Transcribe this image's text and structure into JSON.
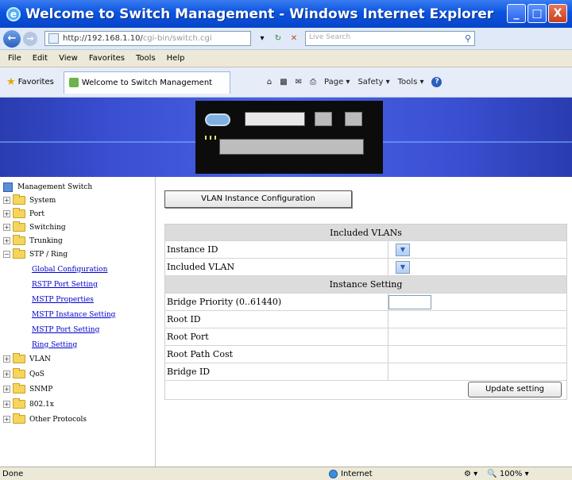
{
  "window": {
    "title": "Welcome to Switch Management - Windows Internet Explorer",
    "controls": [
      "_",
      "□",
      "X"
    ]
  },
  "address_bar": {
    "url_text": "http://192.168.1.10/",
    "url_dim": "cgi-bin/switch.cgi",
    "search_placeholder": "Live Search"
  },
  "menu": [
    "File",
    "Edit",
    "View",
    "Favorites",
    "Tools",
    "Help"
  ],
  "favorites_bar": {
    "favorites_label": "Favorites",
    "tab_title": "Welcome to Switch Management",
    "commands": [
      "Page ▾",
      "Safety ▾",
      "Tools ▾"
    ]
  },
  "sidebar": {
    "root": "Management Switch",
    "items": [
      {
        "label": "System",
        "type": "folder"
      },
      {
        "label": "Port",
        "type": "folder"
      },
      {
        "label": "Switching",
        "type": "folder"
      },
      {
        "label": "Trunking",
        "type": "folder"
      },
      {
        "label": "STP / Ring",
        "type": "folder-open"
      },
      {
        "label": "Global Configuration",
        "type": "link"
      },
      {
        "label": "RSTP Port Setting",
        "type": "link"
      },
      {
        "label": "MSTP Properties",
        "type": "link"
      },
      {
        "label": "MSTP Instance Setting",
        "type": "link"
      },
      {
        "label": "MSTP Port Setting",
        "type": "link"
      },
      {
        "label": "Ring Setting",
        "type": "link"
      },
      {
        "label": "VLAN",
        "type": "folder"
      },
      {
        "label": "QoS",
        "type": "folder"
      },
      {
        "label": "SNMP",
        "type": "folder"
      },
      {
        "label": "802.1x",
        "type": "folder"
      },
      {
        "label": "Other Protocols",
        "type": "folder"
      }
    ]
  },
  "main": {
    "page_title": "VLAN Instance Configuration",
    "included_vlans_header": "Included VLANs",
    "instance_id_label": "Instance ID",
    "included_vlan_label": "Included VLAN",
    "instance_setting_header": "Instance Setting",
    "bridge_priority_label": "Bridge Priority (0..61440)",
    "root_id_label": "Root ID",
    "root_port_label": "Root Port",
    "root_path_cost_label": "Root Path Cost",
    "bridge_id_label": "Bridge ID",
    "update_button": "Update setting"
  },
  "status_bar": {
    "status": "Done",
    "zone": "Internet",
    "zoom": "100%"
  },
  "colors": {
    "titlebar": "#0a54e0",
    "banner": "#3a4fd2",
    "link": "#0000cc"
  }
}
